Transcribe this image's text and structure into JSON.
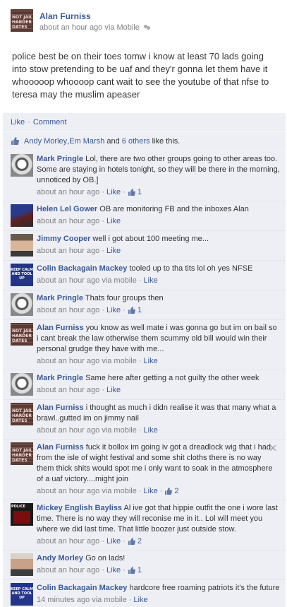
{
  "post": {
    "author": "Alan Furniss",
    "time": "about an hour ago via Mobile",
    "text": "police best be on their toes tomw i know at least 70 lads going into stow pretending to be uaf and they'r gonna let them have it whooooop whoooop cant wait to see the youtube of that nfse to teresa may the muslim apeaser",
    "avatar_text": "NOT JAIL HARDER DATES"
  },
  "actions": {
    "like": "Like",
    "sep": "·",
    "comment": "Comment"
  },
  "likes": {
    "p1": "Andy Morley",
    "sep": ", ",
    "p2": "Em Marsh",
    "and": " and ",
    "others": "6 others",
    "suffix": " like this."
  },
  "colors": {
    "link": "#3b5998",
    "bg": "#edeff4",
    "meta": "#808080"
  },
  "comments": [
    {
      "name": "Mark Pringle",
      "text": "Lol, there are two other groups going to other areas too. Some are staying in hotels tonight, so they will be there in the morning, unnoticed by OB.]",
      "time": "about an hour ago",
      "via": "",
      "like": "Like",
      "count": "1",
      "avatar": "grey",
      "close": false
    },
    {
      "name": "Helen Lel Gower",
      "text": "OB are monitoring FB and the inboxes Alan",
      "time": "about an hour ago",
      "via": "",
      "like": "Like",
      "count": "",
      "avatar": "dark",
      "close": false
    },
    {
      "name": "Jimmy Cooper",
      "text": "well i got about 100 meeting me...",
      "time": "about an hour ago",
      "via": "",
      "like": "Like",
      "count": "",
      "avatar": "face",
      "close": false
    },
    {
      "name": "Colin Backagain Mackey",
      "text": "tooled up to tha tits lol oh yes NFSE",
      "time": "about an hour ago",
      "via": "via mobile",
      "like": "Like",
      "count": "",
      "avatar": "blue",
      "close": false
    },
    {
      "name": "Mark Pringle",
      "text": "Thats four groups then",
      "time": "about an hour ago",
      "via": "",
      "like": "Like",
      "count": "1",
      "avatar": "grey",
      "close": false
    },
    {
      "name": "Alan Furniss",
      "text": "you know as well mate i was gonna go but im on bail so i cant break the law otherwise them scummy old bill would win their personal grudge they have with me...",
      "time": "about an hour ago",
      "via": "via mobile",
      "like": "Like",
      "count": "",
      "avatar": "brick",
      "close": false
    },
    {
      "name": "Mark Pringle",
      "text": "Same here after getting a not guilty the other week",
      "time": "about an hour ago",
      "via": "",
      "like": "Like",
      "count": "",
      "avatar": "grey",
      "close": false
    },
    {
      "name": "Alan Furniss",
      "text": "i thought as much i didn realise it was that many what a brawl..gutted im on jimmy nail",
      "time": "about an hour ago",
      "via": "via mobile",
      "like": "Like",
      "count": "",
      "avatar": "brick",
      "close": false
    },
    {
      "name": "Alan Furniss",
      "text": "fuck it bollox im going iv got a dreadlock wig that i had from the isle of wight festival and some shit cloths there is no way them thick shits would spot me i only want to soak in the atmosphere of a uaf victory....might join",
      "time": "about an hour ago",
      "via": "via mobile",
      "like": "Like",
      "count": "2",
      "avatar": "brick",
      "close": true
    },
    {
      "name": "Mickey English Bayliss",
      "text": "Al ive got that hippie outfit the one i wore last time. There is no way they will reconise me in it.. Lol will meet you where we did last time. That little boozer just outside stow.",
      "time": "about an hour ago",
      "via": "",
      "like": "Like",
      "count": "2",
      "avatar": "police",
      "close": false
    },
    {
      "name": "Andy Morley",
      "text": "Go on lads!",
      "time": "about an hour ago",
      "via": "",
      "like": "Like",
      "count": "1",
      "avatar": "face2",
      "close": false
    },
    {
      "name": "Colin Backagain Mackey",
      "text": "hardcore free roaming patriots it's the future",
      "time": "14 minutes ago",
      "via": "via mobile",
      "like": "Like",
      "count": "",
      "avatar": "blue",
      "close": false
    }
  ],
  "avatar_labels": {
    "brick": "NOT JAIL HARDER DATES",
    "blue": "KEEP CALM AND TOOL UP",
    "police": "POLICE"
  }
}
